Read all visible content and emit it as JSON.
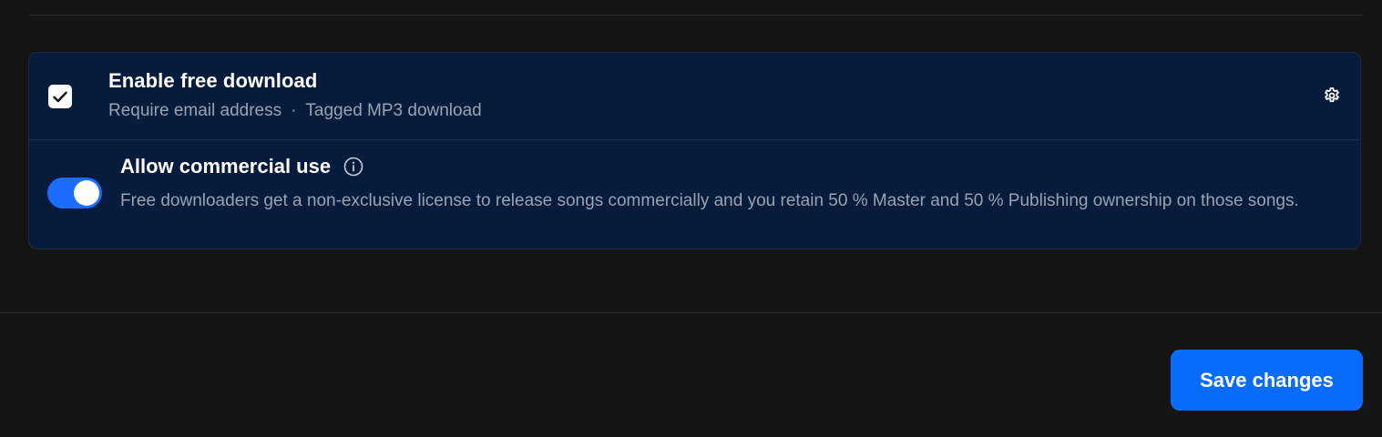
{
  "download_option": {
    "title": "Enable free download",
    "checked": true,
    "details": [
      "Require email address",
      "Tagged MP3 download"
    ],
    "separator": "·",
    "settings_icon": "gear-icon"
  },
  "commercial_option": {
    "title": "Allow commercial use",
    "enabled": true,
    "info_icon": "info-icon",
    "description": "Free downloaders get a non-exclusive license to release songs commercially and you retain 50 % Master and 50 % Publishing ownership on those songs."
  },
  "footer": {
    "save_label": "Save changes"
  },
  "colors": {
    "background": "#141414",
    "card": "#071b3c",
    "accent": "#0a6cff",
    "muted_text": "#9aa3b2"
  }
}
